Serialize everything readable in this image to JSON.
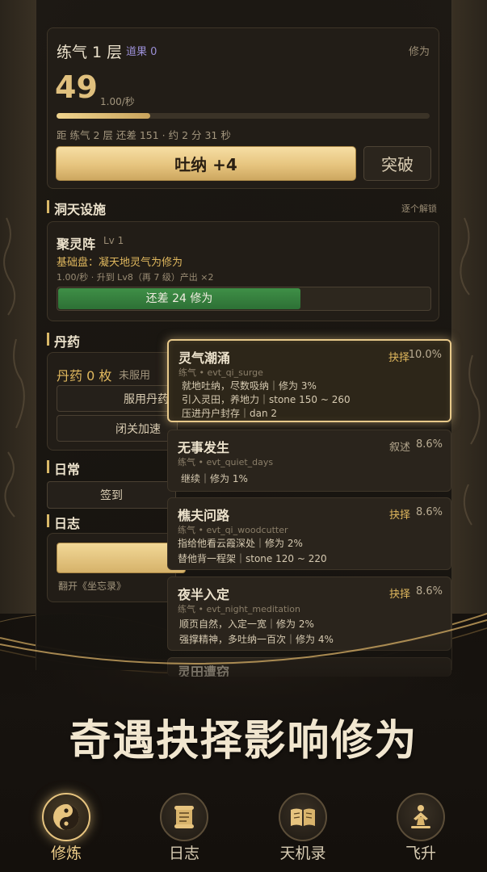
{
  "cultivation": {
    "realm": "练气 1 层",
    "dao_fruit": "道果 0",
    "xiuwei_label": "修为",
    "value": "49",
    "rate": "1.00/秒",
    "progress": 0.25,
    "remaining": "距 练气 2 层 还差 151 · 约 2 分 31 秒",
    "tuna_button": "吐纳 +4",
    "breakthrough_button": "突破"
  },
  "dongtian": {
    "title": "洞天设施",
    "hint": "逐个解锁",
    "array_name": "聚灵阵",
    "array_level": "Lv 1",
    "array_desc": "基础盘：凝天地灵气为修为",
    "array_meta": "1.00/秒 · 升到 Lv8（再 7 级）产出 ×2",
    "upgrade_label": "还差 24 修为",
    "upgrade_progress": 0.65
  },
  "pills": {
    "title": "丹药",
    "count": "丹药 0 枚",
    "used": "未服用",
    "use_button": "服用丹药",
    "seclude_button": "闭关加速"
  },
  "daily": {
    "title": "日常",
    "checkin_button": "签到"
  },
  "log": {
    "title": "日志",
    "text": "翻开《坐忘录》"
  },
  "events": [
    {
      "title": "灵气潮涌",
      "tag": "抉择",
      "prob": "10.0%",
      "id": "练气 • evt_qi_surge",
      "lines": [
        "就地吐纳，尽数吸纳｜修为 3%",
        "引入灵田，养地力｜stone 150 ~ 260",
        "压进丹户封存｜dan 2"
      ]
    },
    {
      "title": "无事发生",
      "tag": "叙述",
      "prob": "8.6%",
      "id": "练气 • evt_quiet_days",
      "lines": [
        "继续｜修为 1%"
      ]
    },
    {
      "title": "樵夫问路",
      "tag": "抉择",
      "prob": "8.6%",
      "id": "练气 • evt_qi_woodcutter",
      "lines": [
        "指给他看云霞深处｜修为 2%",
        "替他背一程架｜stone 120 ~ 220"
      ]
    },
    {
      "title": "夜半入定",
      "tag": "抉择",
      "prob": "8.6%",
      "id": "练气 • evt_night_meditation",
      "lines": [
        "顺页自然，入定一宽｜修为 2%",
        "强撑精神，多吐纳一百次｜修为 4%"
      ]
    },
    {
      "title": "灵田遭窃"
    }
  ],
  "slogan": "奇遇抉择影响修为",
  "tabs": [
    {
      "label": "修炼",
      "icon": "yin-yang-icon",
      "active": true
    },
    {
      "label": "日志",
      "icon": "scroll-icon",
      "active": false
    },
    {
      "label": "天机录",
      "icon": "open-book-icon",
      "active": false
    },
    {
      "label": "飞升",
      "icon": "ascend-figure-icon",
      "active": false
    }
  ],
  "colors": {
    "gold": "#e0c07e",
    "accent_text": "#e0b85e",
    "progress_green": "#3f8f47",
    "dao_purple": "#9b8fd6"
  }
}
